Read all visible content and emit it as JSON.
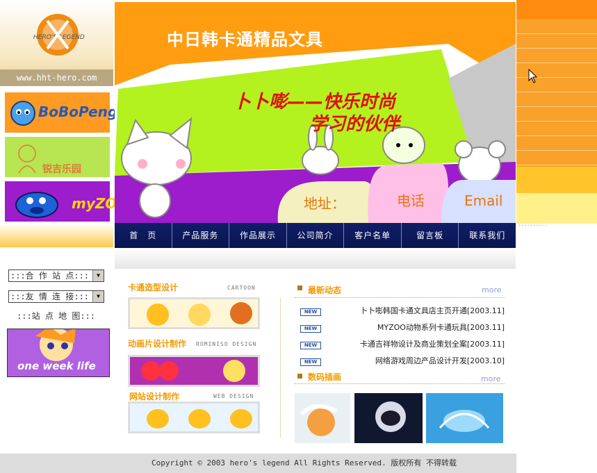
{
  "site": {
    "url_text": "www.hht-hero.com",
    "logo_alt_text": "HERO'S LEGEND"
  },
  "brands": [
    {
      "label": "BoBoPeng"
    },
    {
      "label": "锐吉乐园"
    },
    {
      "label": "myZO"
    }
  ],
  "selects": [
    {
      "value": ":::合 作 站 点:::"
    },
    {
      "value": ":::友 情 连 接:::"
    }
  ],
  "sitemap_text": ":::站 点 地 图:::",
  "promo_text": "one week life",
  "banner": {
    "title": "中日韩卡通精品文具",
    "slogan_line1": "卜卜嘭——快乐时尚",
    "slogan_line2": "学习的伙伴",
    "tab_address": "地址：",
    "tab_phone": "电话",
    "tab_email": "Email"
  },
  "nav": {
    "items": [
      "首　页",
      "产品服务",
      "作品展示",
      "公司简介",
      "客户名单",
      "留言板",
      "联系我们"
    ]
  },
  "sections": [
    {
      "title": "卡通造型设计",
      "en": "CARTOON"
    },
    {
      "title": "动画片设计制作",
      "en": "ROMINISO DESIGN"
    },
    {
      "title": "网站设计制作",
      "en": "WEB DESIGN"
    }
  ],
  "news": {
    "title": "最新动态",
    "more": "more",
    "badge": "NEW",
    "items": [
      "卜卜嘭韩国卡通文具店主页开通[2003.11]",
      "MYZOO动物系列卡通玩具[2003.11]",
      "卡通吉祥物设计及商业策划全案[2003.11]",
      "网络游戏周边产品设计开发[2003.10]"
    ]
  },
  "digital": {
    "title": "数码插画",
    "more": "more"
  },
  "footer_text": "Copyright © 2003 hero's legend All Rights Reserved. 版权所有 不得转载",
  "colors": {
    "accent_orange": "#ff9c10",
    "nav_navy": "#101e66",
    "lime": "#b3f21f",
    "purple": "#9d1ccb",
    "slogan_red": "#e01010"
  }
}
